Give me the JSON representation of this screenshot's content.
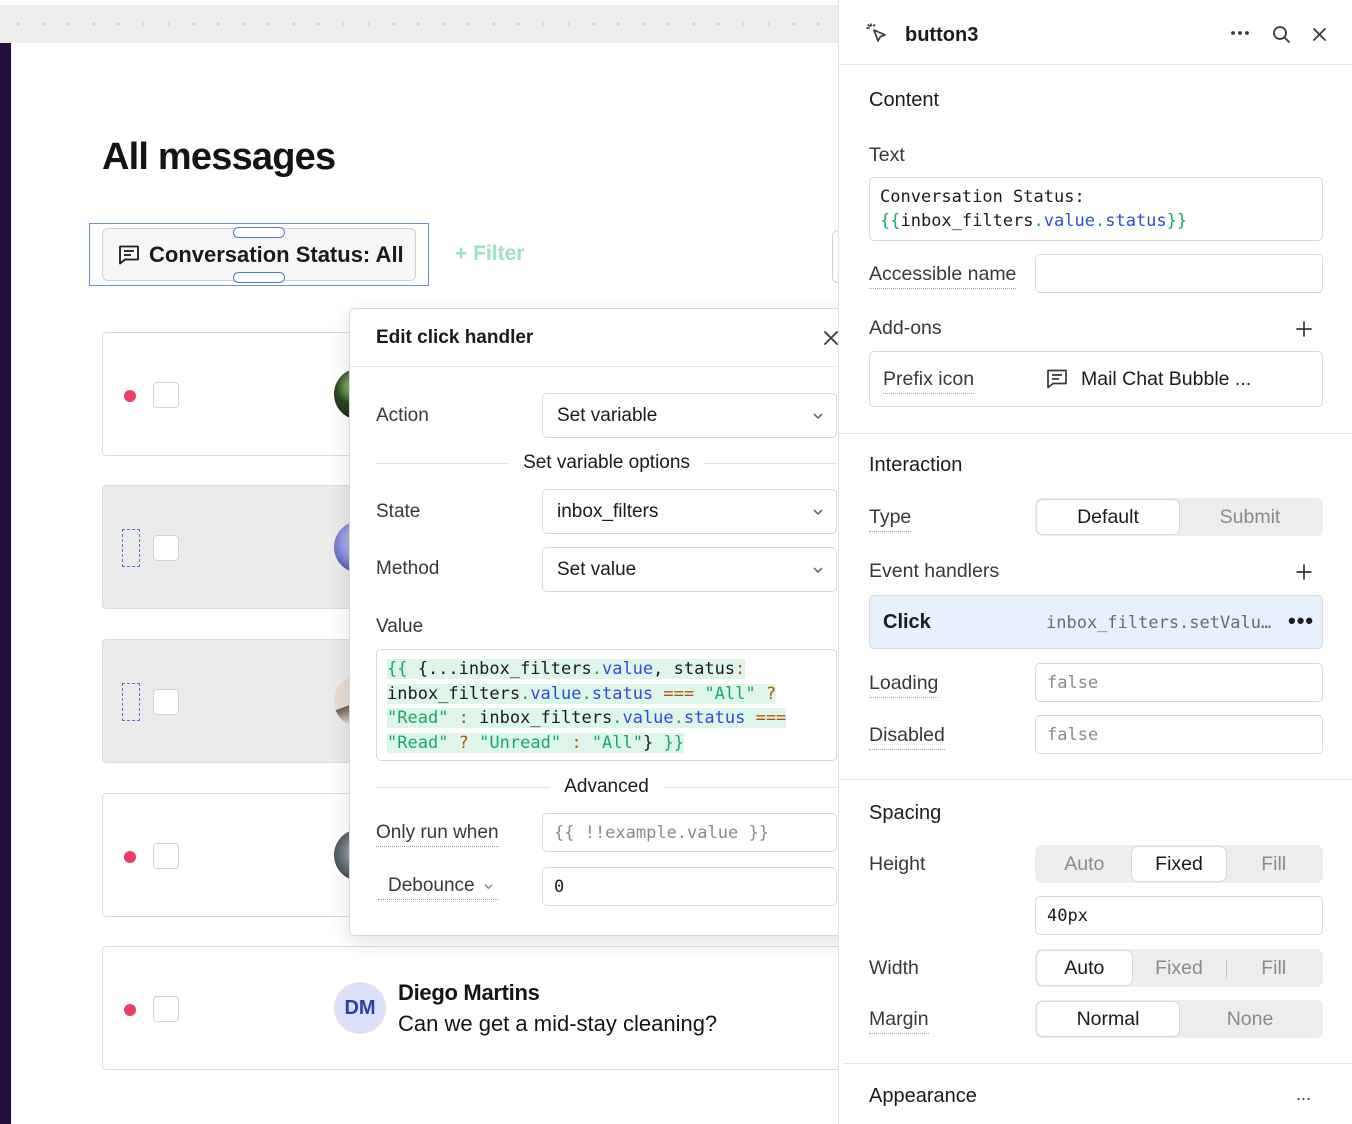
{
  "canvas": {
    "page_title": "All messages",
    "status_button_label": "Conversation Status: All",
    "filter_link": "+ Filter",
    "rows": [
      {
        "unread": true,
        "shaded": false,
        "avatar": "photo-dark-green"
      },
      {
        "unread": false,
        "shaded": true,
        "avatar": "photo-purple"
      },
      {
        "unread": false,
        "shaded": true,
        "avatar": "photo-beige"
      },
      {
        "unread": true,
        "shaded": false,
        "avatar": "photo-gray"
      },
      {
        "unread": true,
        "shaded": false,
        "initials": "DM",
        "name": "Diego Martins",
        "message": "Can we get a mid-stay cleaning?"
      }
    ]
  },
  "modal": {
    "title": "Edit click handler",
    "action_label": "Action",
    "action_value": "Set variable",
    "section_options": "Set variable options",
    "state_label": "State",
    "state_value": "inbox_filters",
    "method_label": "Method",
    "method_value": "Set value",
    "value_label": "Value",
    "value_code": "{{ {...inbox_filters.value, status: inbox_filters.value.status === \"All\" ? \"Read\" : inbox_filters.value.status === \"Read\" ? \"Unread\" : \"All\"} }}",
    "section_advanced": "Advanced",
    "only_run_label": "Only run when",
    "only_run_placeholder": "{{ !!example.value }}",
    "debounce_label": "Debounce",
    "debounce_value": "0"
  },
  "inspector": {
    "title": "button3",
    "content_section": "Content",
    "text_label": "Text",
    "text_value_prefix": "Conversation Status:",
    "text_value_expr": "{{inbox_filters.value.status}}",
    "accessible_name_label": "Accessible name",
    "accessible_name_value": "",
    "addons_label": "Add-ons",
    "prefix_icon_label": "Prefix icon",
    "prefix_icon_value": "Mail Chat Bubble ...",
    "interaction_section": "Interaction",
    "type_label": "Type",
    "type_options": [
      "Default",
      "Submit"
    ],
    "type_selected": "Default",
    "event_handlers_label": "Event handlers",
    "event_name": "Click",
    "event_value": "inbox_filters.setValue(...)",
    "loading_label": "Loading",
    "loading_placeholder": "false",
    "disabled_label": "Disabled",
    "disabled_placeholder": "false",
    "spacing_section": "Spacing",
    "height_label": "Height",
    "height_options": [
      "Auto",
      "Fixed",
      "Fill"
    ],
    "height_selected": "Fixed",
    "height_value": "40px",
    "width_label": "Width",
    "width_options": [
      "Auto",
      "Fixed",
      "Fill"
    ],
    "width_selected": "Auto",
    "margin_label": "Margin",
    "margin_options": [
      "Normal",
      "None"
    ],
    "margin_selected": "Normal",
    "appearance_section": "Appearance",
    "appearance_more": "..."
  },
  "colors": {
    "unread_dot": "#ec3e68",
    "selection_blue": "#4a78d4",
    "filter_green": "#9be4c2",
    "event_row_bg": "#e7f0fd",
    "rail": "#250d3a"
  }
}
